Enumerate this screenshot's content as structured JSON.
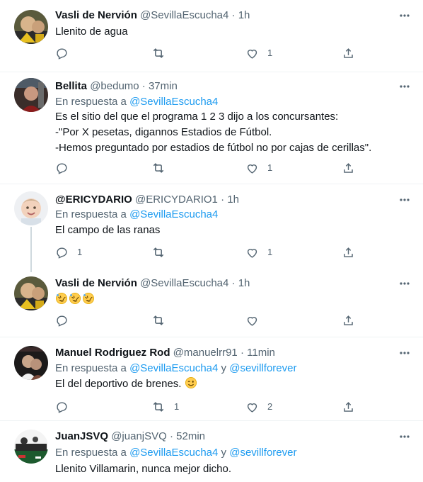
{
  "tweets": [
    {
      "name": "Vasli de Nervión",
      "handle": "@SevillaEscucha4",
      "separator": "·",
      "time": "1h",
      "text": [
        "Llenito de agua"
      ],
      "counts": {
        "reply": "",
        "retweet": "",
        "like": "1"
      }
    },
    {
      "name": "Bellita",
      "handle": "@bedumo",
      "separator": "·",
      "time": "37min",
      "reply_prefix": "En respuesta a",
      "reply_to": "@SevillaEscucha4",
      "text": [
        "Es el sitio del que el programa 1 2 3 dijo a los concursantes:",
        "-\"Por X pesetas, digannos Estadios de Fútbol.",
        "-Hemos preguntado por estadios de fútbol no por cajas de cerillas\"."
      ],
      "counts": {
        "reply": "",
        "retweet": "",
        "like": "1"
      }
    },
    {
      "name": "@ERICYDARIO",
      "handle": "@ERICYDARIO1",
      "separator": "·",
      "time": "1h",
      "reply_prefix": "En respuesta a",
      "reply_to": "@SevillaEscucha4",
      "text": [
        "El campo de las ranas"
      ],
      "counts": {
        "reply": "1",
        "retweet": "",
        "like": "1"
      }
    },
    {
      "name": "Vasli de Nervión",
      "handle": "@SevillaEscucha4",
      "separator": "·",
      "time": "1h",
      "emoji_name": "rolling-on-the-floor-laughing",
      "counts": {
        "reply": "",
        "retweet": "",
        "like": ""
      }
    },
    {
      "name": "Manuel Rodriguez Rod",
      "handle": "@manuelrr91",
      "separator": "·",
      "time": "11min",
      "reply_prefix": "En respuesta a",
      "reply_to": "@SevillaEscucha4",
      "reply_and": "y",
      "reply_to2": "@sevillforever",
      "text": [
        "El del deportivo de brenes."
      ],
      "text_emoji": "winking-face",
      "counts": {
        "reply": "",
        "retweet": "1",
        "like": "2"
      }
    },
    {
      "name": "JuanJSVQ",
      "handle": "@juanjSVQ",
      "separator": "·",
      "time": "52min",
      "reply_prefix": "En respuesta a",
      "reply_to": "@SevillaEscucha4",
      "reply_and": "y",
      "reply_to2": "@sevillforever",
      "text": [
        "Llenito Villamarin, nunca mejor dicho."
      ]
    }
  ],
  "icons": {
    "reply": "reply-icon",
    "retweet": "retweet-icon",
    "like": "like-icon",
    "share": "share-icon",
    "more": "more-icon"
  },
  "colors": {
    "text": "#0f1419",
    "secondary": "#536471",
    "link": "#1d9bf0",
    "divider": "#eff3f4",
    "thread": "#cfd9de"
  }
}
